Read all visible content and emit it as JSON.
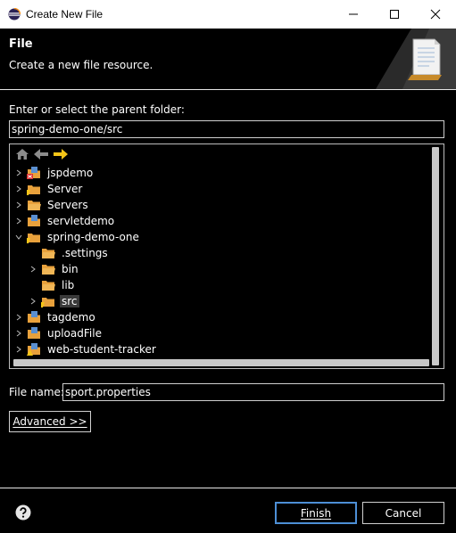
{
  "window": {
    "title": "Create New File"
  },
  "header": {
    "title": "File",
    "description": "Create a new file resource."
  },
  "parent_folder": {
    "label": "Enter or select the parent folder:",
    "value": "spring-demo-one/src"
  },
  "tree": {
    "items": [
      {
        "label": "jspdemo"
      },
      {
        "label": "Server"
      },
      {
        "label": "Servers"
      },
      {
        "label": "servletdemo"
      },
      {
        "label": "spring-demo-one"
      },
      {
        "label": ".settings"
      },
      {
        "label": "bin"
      },
      {
        "label": "lib"
      },
      {
        "label": "src"
      },
      {
        "label": "tagdemo"
      },
      {
        "label": "uploadFile"
      },
      {
        "label": "web-student-tracker"
      }
    ]
  },
  "file_name": {
    "label": "File name:",
    "value": "sport.properties"
  },
  "buttons": {
    "advanced": "Advanced >>",
    "finish": "Finish",
    "cancel": "Cancel"
  },
  "colors": {
    "accent": "#4d8fd6",
    "folder": "#e8a13c",
    "nav_arrow": "#f5c518"
  }
}
